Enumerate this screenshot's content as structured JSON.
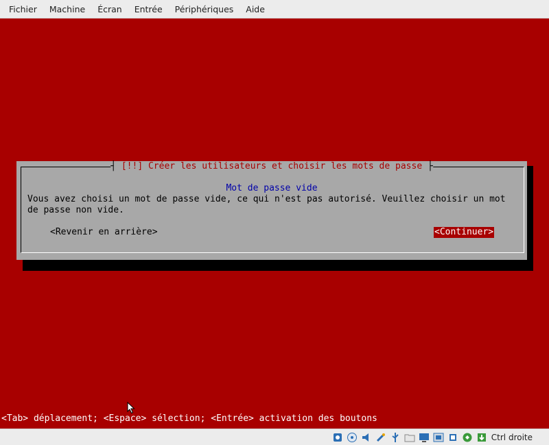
{
  "menubar": {
    "items": [
      "Fichier",
      "Machine",
      "Écran",
      "Entrée",
      "Périphériques",
      "Aide"
    ]
  },
  "dialog": {
    "title": "[!!] Créer les utilisateurs et choisir les mots de passe",
    "subtitle": "Mot de passe vide",
    "body": "Vous avez choisi un mot de passe vide, ce qui n'est pas autorisé. Veuillez choisir un mot\nde passe non vide.",
    "back_label": "<Revenir en arrière>",
    "continue_label": "<Continuer>"
  },
  "help_line": "<Tab> déplacement; <Espace> sélection; <Entrée> activation des boutons",
  "statusbar": {
    "icons": [
      "hard-disk-icon",
      "optical-drive-icon",
      "audio-icon",
      "network-icon",
      "usb-icon",
      "shared-folder-icon",
      "display-icon",
      "video-capture-icon",
      "cpu-icon",
      "mouse-integration-icon",
      "keyboard-capture-icon"
    ],
    "host_key": "Ctrl droite"
  },
  "colors": {
    "screen_bg": "#a80000",
    "dialog_bg": "#a8a8a8",
    "title_fg": "#a80000",
    "subtitle_fg": "#0000a8",
    "selected_button_bg": "#a80000"
  }
}
